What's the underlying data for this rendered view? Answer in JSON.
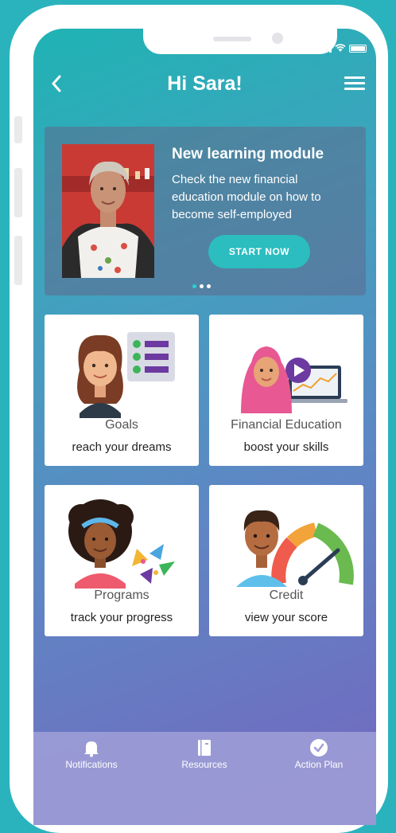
{
  "header": {
    "title": "Hi Sara!",
    "back_icon": "chevron-left-icon",
    "menu_icon": "hamburger-menu-icon"
  },
  "banner": {
    "title": "New learning module",
    "text": "Check the new financial education module on how to become self-employed",
    "button_label": "START NOW",
    "carousel": {
      "total": 3,
      "active": 1
    }
  },
  "cards": [
    {
      "title": "Goals",
      "subtitle": "reach your dreams"
    },
    {
      "title": "Financial Education",
      "subtitle": "boost your skills"
    },
    {
      "title": "Programs",
      "subtitle": "track your progress"
    },
    {
      "title": "Credit",
      "subtitle": "view your score"
    }
  ],
  "tabbar": {
    "items": [
      {
        "label": "Notifications",
        "icon": "bell-icon"
      },
      {
        "label": "Resources",
        "icon": "book-icon"
      },
      {
        "label": "Action Plan",
        "icon": "check-circle-icon"
      }
    ]
  },
  "colors": {
    "accent": "#2bbdbf",
    "gradient_start": "#1fb3b4",
    "gradient_end": "#7466bf",
    "frame": "#2bb3bd"
  }
}
